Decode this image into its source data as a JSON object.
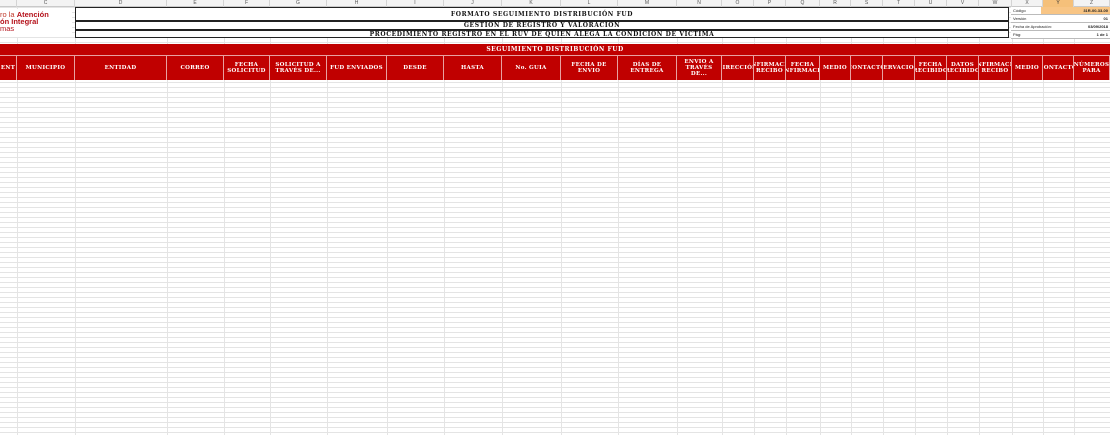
{
  "sheet": {
    "column_letters": [
      "",
      "C",
      "D",
      "E",
      "F",
      "G",
      "H",
      "I",
      "J",
      "K",
      "L",
      "M",
      "N",
      "O",
      "P",
      "Q",
      "R",
      "S",
      "T",
      "U",
      "V",
      "W",
      "X",
      "Y",
      "Z"
    ],
    "selected_column": "Y"
  },
  "logo": {
    "line1_a": "ro la ",
    "line1_b": "Atención",
    "line2": "ón Integral",
    "line3": "mas"
  },
  "title": {
    "line1": "FORMATO SEGUIMIENTO DISTRIBUCIÓN FUD",
    "line2": "GESTIÓN DE REGISTRO Y VALORACIÓN",
    "line3": "PROCEDIMIENTO REGISTRO EN EL RUV DE QUIEN ALEGA LA CONDICIÓN DE VÍCTIMA"
  },
  "meta": {
    "code_label": "Código",
    "code_value": "31R-00-33-00",
    "version_label": "Versión",
    "version_value": "01",
    "date_label": "Fecha de Aprobación:",
    "date_value": "03/09/2018",
    "page_label": "Pág:",
    "page_value": "1 de 1"
  },
  "band": {
    "title": "SEGUIMIENTO DISTRIBUCIÓN FUD"
  },
  "headers": [
    "ENT",
    "MUNICIPIO",
    "ENTIDAD",
    "CORREO",
    "FECHA SOLICITUD",
    "SOLICITUD A TRAVÉS DE...",
    "FUD ENVIADOS",
    "DESDE",
    "HASTA",
    "No. GUIA",
    "FECHA DE ENVIO",
    "DÍAS DE ENTREGA",
    "ENVIO A TRAVÉS DE...",
    "DIRECCIÓN",
    "CONFIRMACIÓN RECIBO",
    "FECHA CONFIRMACIÓN",
    "MEDIO",
    "CONTACTO",
    "OBSERVACIONES",
    "FECHA RECIBIDO",
    "DATOS RECIBIDO",
    "CONFIRMACIÓN RECIBO",
    "MEDIO",
    "CONTACTO",
    "NÚMEROS PARA"
  ],
  "colors": {
    "header_red": "#c00000",
    "selected_column": "#f8c585",
    "logo_red": "#b5121b"
  }
}
